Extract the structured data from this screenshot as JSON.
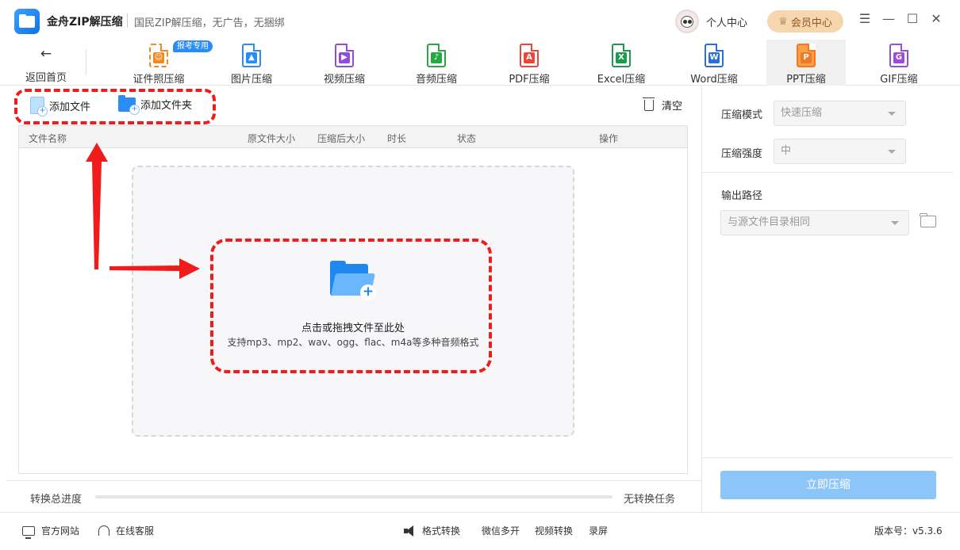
{
  "app": {
    "name": "金舟ZIP解压缩",
    "slogan": "国民ZIP解压缩，无广告，无捆绑",
    "user_center": "个人中心",
    "vip_center": "会员中心"
  },
  "toolbar": {
    "back_label": "返回首页",
    "tools": [
      {
        "label": "证件照压缩",
        "icon": "id-photo-icon",
        "color": "#f08a24"
      },
      {
        "label": "图片压缩",
        "icon": "image-file-icon",
        "color": "#2b8cf5"
      },
      {
        "label": "视频压缩",
        "icon": "video-file-icon",
        "color": "#8f4dd8"
      },
      {
        "label": "音频压缩",
        "icon": "audio-file-icon",
        "color": "#27a845"
      },
      {
        "label": "PDF压缩",
        "icon": "pdf-file-icon",
        "color": "#e8473b"
      },
      {
        "label": "Excel压缩",
        "icon": "excel-file-icon",
        "color": "#1e9a4d"
      },
      {
        "label": "Word压缩",
        "icon": "word-file-icon",
        "color": "#2b6fd6"
      },
      {
        "label": "PPT压缩",
        "icon": "ppt-file-icon",
        "color": "#f07a24",
        "active": true
      },
      {
        "label": "GIF压缩",
        "icon": "gif-file-icon",
        "color": "#9b4dd8"
      }
    ],
    "badge": "报考专用"
  },
  "file_area": {
    "add_file": "添加文件",
    "add_folder": "添加文件夹",
    "clear": "清空",
    "columns": [
      "文件名称",
      "原文件大小",
      "压缩后大小",
      "时长",
      "状态",
      "操作"
    ],
    "drop_title": "点击或拖拽文件至此处",
    "drop_subtitle": "支持mp3、mp2、wav、ogg、flac、m4a等多种音频格式"
  },
  "progress": {
    "label": "转换总进度",
    "status": "无转换任务",
    "value": 0
  },
  "settings": {
    "mode_label": "压缩模式",
    "mode_value": "快速压缩",
    "strength_label": "压缩强度",
    "strength_value": "中",
    "output_label": "输出路径",
    "output_value": "与源文件目录相同",
    "compress_button": "立即压缩"
  },
  "footer": {
    "website": "官方网站",
    "service": "在线客服",
    "links": [
      "格式转换",
      "微信多开",
      "视频转换",
      "录屏"
    ],
    "version": "版本号：v5.3.6"
  },
  "colors": {
    "accent": "#2b8cf5",
    "annotation": "#f01c1c",
    "vip_bg": "#f6d6ae",
    "compress_btn": "#8cc6f8"
  }
}
